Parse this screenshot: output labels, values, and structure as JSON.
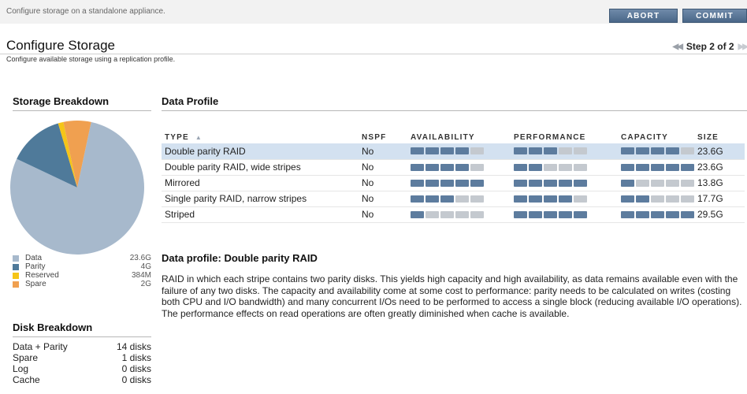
{
  "header": {
    "subtitle": "Configure storage on a standalone appliance.",
    "abort_label": "ABORT",
    "commit_label": "COMMIT"
  },
  "page": {
    "title": "Configure Storage",
    "description": "Configure available storage using a replication profile.",
    "step": "Step 2 of 2"
  },
  "storage_breakdown": {
    "title": "Storage Breakdown",
    "legend": [
      {
        "label": "Data",
        "value": "23.6G",
        "color": "#a7b9cc"
      },
      {
        "label": "Parity",
        "value": "4G",
        "color": "#4f7a9a"
      },
      {
        "label": "Reserved",
        "value": "384M",
        "color": "#f5c518"
      },
      {
        "label": "Spare",
        "value": "2G",
        "color": "#f0a050"
      }
    ]
  },
  "chart_data": {
    "type": "pie",
    "labels": [
      "Data",
      "Parity",
      "Reserved",
      "Spare"
    ],
    "values": [
      23.6,
      4,
      0.384,
      2
    ],
    "units": "GB",
    "colors": [
      "#a7b9cc",
      "#4f7a9a",
      "#f5c518",
      "#f0a050"
    ]
  },
  "disk_breakdown": {
    "title": "Disk Breakdown",
    "rows": [
      {
        "label": "Data + Parity",
        "value": "14 disks"
      },
      {
        "label": "Spare",
        "value": "1 disks"
      },
      {
        "label": "Log",
        "value": "0 disks"
      },
      {
        "label": "Cache",
        "value": "0 disks"
      }
    ]
  },
  "data_profile": {
    "title": "Data Profile",
    "columns": [
      "TYPE",
      "NSPF",
      "AVAILABILITY",
      "PERFORMANCE",
      "CAPACITY",
      "SIZE"
    ],
    "sort_indicator": "▲",
    "rows": [
      {
        "type": "Double parity RAID",
        "nspf": "No",
        "availability": 4,
        "performance": 3,
        "capacity": 4,
        "size": "23.6G",
        "selected": true
      },
      {
        "type": "Double parity RAID, wide stripes",
        "nspf": "No",
        "availability": 4,
        "performance": 2,
        "capacity": 5,
        "size": "23.6G",
        "selected": false
      },
      {
        "type": "Mirrored",
        "nspf": "No",
        "availability": 5,
        "performance": 5,
        "capacity": 1,
        "size": "13.8G",
        "selected": false
      },
      {
        "type": "Single parity RAID, narrow stripes",
        "nspf": "No",
        "availability": 3,
        "performance": 4,
        "capacity": 2,
        "size": "17.7G",
        "selected": false
      },
      {
        "type": "Striped",
        "nspf": "No",
        "availability": 1,
        "performance": 5,
        "capacity": 5,
        "size": "29.5G",
        "selected": false
      }
    ]
  },
  "profile_detail": {
    "title": "Data profile: Double parity RAID",
    "text": "RAID in which each stripe contains two parity disks.  This yields high capacity and high availability, as data remains available even with the failure of any two disks.  The capacity and availability come at some cost to performance: parity needs to be calculated on writes (costing both CPU and I/O bandwidth) and many concurrent I/Os need to be performed to access a single block (reducing available I/O operations).  The performance effects on read operations are often greatly diminished when cache is available."
  }
}
